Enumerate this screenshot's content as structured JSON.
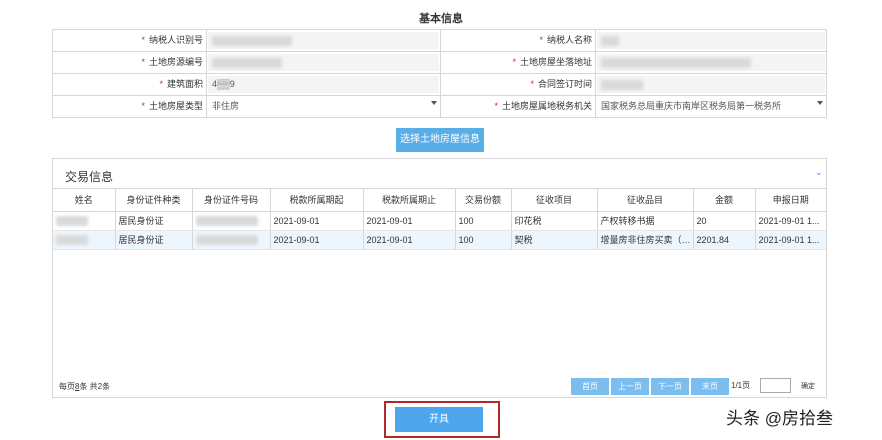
{
  "section_title": "基本信息",
  "form": {
    "rows": [
      {
        "left": {
          "label": "纳税人识别号",
          "value": "",
          "kind": "input"
        },
        "right": {
          "label": "纳税人名称",
          "value": "",
          "kind": "input"
        }
      },
      {
        "left": {
          "label": "土地房源编号",
          "value": "",
          "kind": "input"
        },
        "right": {
          "label": "土地房屋坐落地址",
          "value": "",
          "kind": "input"
        }
      },
      {
        "left": {
          "label": "建筑面积",
          "value": "4▒▒9",
          "kind": "input"
        },
        "right": {
          "label": "合同签订时间",
          "value": "",
          "kind": "input"
        }
      },
      {
        "left": {
          "label": "土地房屋类型",
          "value": "非住房",
          "kind": "select"
        },
        "right": {
          "label": "土地房屋属地税务机关",
          "value": "国家税务总局重庆市南岸区税务局第一税务所",
          "kind": "select"
        }
      }
    ],
    "required_mark": "*"
  },
  "select_button_label": "选择土地房屋信息",
  "transactions": {
    "title": "交易信息",
    "collapse_icon": "chevron-down-icon",
    "columns": [
      "姓名",
      "身份证件种类",
      "身份证件号码",
      "税款所属期起",
      "税款所属期止",
      "交易份额",
      "征收项目",
      "征收品目",
      "金额",
      "申报日期"
    ],
    "rows": [
      [
        "",
        "居民身份证",
        "",
        "2021-09-01",
        "2021-09-01",
        "100",
        "印花税",
        "产权转移书据",
        "20",
        "2021-09-01 1..."
      ],
      [
        "",
        "居民身份证",
        "",
        "2021-09-01",
        "2021-09-01",
        "100",
        "契税",
        "增量房非住房买卖（其...",
        "2201.84",
        "2021-09-01 1..."
      ]
    ],
    "pager": {
      "info_prefix": "每页",
      "page_size": "8",
      "info_suffix": "条 共2条",
      "first": "首页",
      "prev": "上一页",
      "next": "下一页",
      "last": "末页",
      "page_indicator": "1/1页",
      "confirm": "确定"
    }
  },
  "issue_button_label": "开具",
  "watermark": "头条 @房拾叁",
  "colors": {
    "accent_blue": "#5aaee8",
    "highlight_border": "#b02a2a",
    "required_red": "#e02020"
  }
}
